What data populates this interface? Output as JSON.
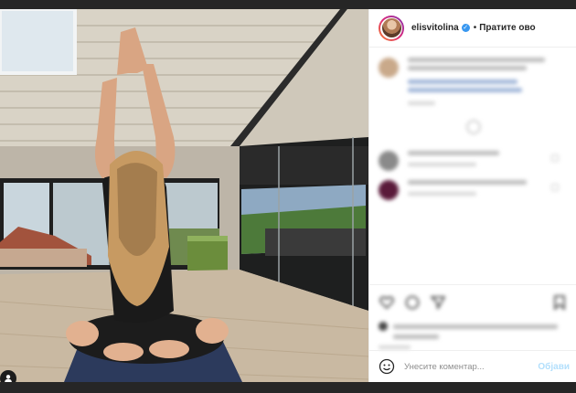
{
  "post": {
    "username": "elisvitolina",
    "separator": "•",
    "follow_label": "Пратите ово"
  },
  "comment_box": {
    "placeholder": "Унесите коментар...",
    "post_label": "Објави"
  },
  "icons": {
    "like": "heart-icon",
    "comment": "comment-icon",
    "share": "share-icon",
    "save": "bookmark-icon",
    "emoji": "emoji-icon",
    "user_tag": "user-tag-icon",
    "verified": "verified-badge-icon"
  },
  "colors": {
    "accent": "#3897f0",
    "post_button_disabled": "#b2dffc",
    "text": "#262626",
    "placeholder": "#8e8e8e"
  }
}
